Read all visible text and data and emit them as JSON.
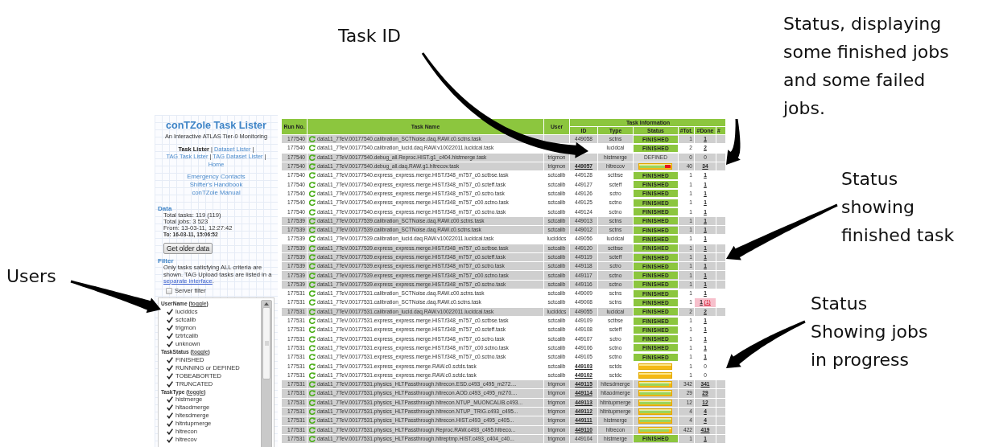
{
  "callouts": [
    {
      "text": "Task ID"
    },
    {
      "text": "Status, displaying\nsome finished jobs\nand some failed\njobs."
    },
    {
      "text": "Status\nshowing\nfinished task"
    },
    {
      "text": "Users"
    },
    {
      "text": "Status\nShowing jobs\nin progress"
    }
  ],
  "sidebar": {
    "title": "conTZole Task Lister",
    "subtitle": "An Interactive ATLAS Tier-0 Monitoring",
    "nav": [
      {
        "label": "Task Lister",
        "current": true
      },
      {
        "label": "Dataset Lister",
        "current": false
      },
      {
        "label": "TAG Task Lister",
        "current": false
      },
      {
        "label": "TAG Dataset Lister",
        "current": false
      },
      {
        "label": "Home",
        "current": false
      }
    ],
    "separator": "|",
    "links": [
      "Emergency Contacts",
      "Shifter's Handbook",
      "conTZole Manual"
    ],
    "data": {
      "heading": "Data",
      "lines": [
        {
          "text": "Total tasks: 119 (119)",
          "bold": false
        },
        {
          "text": "Total jobs: 3 523",
          "bold": false
        },
        {
          "text": "From: 13-03-11, 12:27:42",
          "bold": false
        },
        {
          "text": "To: 16-03-11, 15:06:52",
          "bold": true
        }
      ]
    },
    "older_button": "Get older data",
    "filter": {
      "heading": "Filter",
      "text": "Only tasks satisfying ALL criteria are shown. TAG Upload tasks are listed in a ",
      "link": "separate interface",
      "end": "."
    },
    "server_filter": {
      "label": "Server filter",
      "checked": false
    },
    "toggle_brackets": [
      "(",
      ")"
    ],
    "groups": [
      {
        "heading": "UserName",
        "toggle": "toggle",
        "items": [
          {
            "label": "luciddcs",
            "checked": true
          },
          {
            "label": "sctcalib",
            "checked": true
          },
          {
            "label": "trigmon",
            "checked": true
          },
          {
            "label": "tztrtcalib",
            "checked": true
          },
          {
            "label": "unknown",
            "checked": true
          }
        ]
      },
      {
        "heading": "TaskStatus",
        "toggle": "toggle",
        "items": [
          {
            "label": "FINISHED",
            "checked": true
          },
          {
            "label": "RUNNING or DEFINED",
            "checked": true
          },
          {
            "label": "TOBEABORTED",
            "checked": true
          },
          {
            "label": "TRUNCATED",
            "checked": true
          }
        ]
      },
      {
        "heading": "TaskType",
        "toggle": "toggle",
        "items": [
          {
            "label": "histmerge",
            "checked": true
          },
          {
            "label": "hltaodmerge",
            "checked": true
          },
          {
            "label": "hltesdmerge",
            "checked": true
          },
          {
            "label": "hltntupmerge",
            "checked": true
          },
          {
            "label": "hltrecon",
            "checked": true
          },
          {
            "label": "hltrecov",
            "checked": true
          }
        ]
      }
    ]
  },
  "table": {
    "group_header": "Task Information",
    "columns": [
      {
        "label": "Run No.",
        "grouped": false
      },
      {
        "label": "Task Name",
        "grouped": false
      },
      {
        "label": "User",
        "grouped": false
      },
      {
        "label": "ID",
        "grouped": true
      },
      {
        "label": "Type",
        "grouped": true
      },
      {
        "label": "Status",
        "grouped": true
      },
      {
        "label": "#Tot.",
        "grouped": true
      },
      {
        "label": "#Done",
        "grouped": true
      },
      {
        "label": "#",
        "grouped": true
      }
    ],
    "rows": [
      {
        "run": "177540",
        "name": "data11_7TeV.00177540.calibration_SCTNoise.daq.RAW.c0.sctns.task",
        "id": "449058",
        "id_link": false,
        "type": "sctns",
        "status": {
          "kind": "finished",
          "text": "FINISHED"
        },
        "total": "1",
        "done": "1",
        "done_link": true,
        "shaded": true
      },
      {
        "run": "177540",
        "name": "data11_7TeV.00177540.calibration_lucid.daq.RAW.v10022011.lucidcal.task",
        "type": "lucidcal",
        "status": {
          "kind": "finished",
          "text": "FINISHED"
        },
        "total": "2",
        "done": "2",
        "done_link": true,
        "shaded": false
      },
      {
        "run": "177540",
        "name": "data11_7TeV.00177540.debug_all.Reproc.HIST.g1_c404.histmerge.task",
        "user": "trigmon",
        "type": "histmerge",
        "status": {
          "kind": "defined",
          "text": "DEFINED"
        },
        "total": "0",
        "done": "0",
        "done_link": false,
        "shaded": true
      },
      {
        "run": "177540",
        "name": "data11_7TeV.00177540.debug_all.daq.RAW.g1.hltrecov.task",
        "user": "trigmon",
        "id": "449057",
        "id_link": true,
        "type": "hltrecov",
        "status": {
          "kind": "progress",
          "level": 0.82,
          "failures": true
        },
        "total": "40",
        "done": "34",
        "done_link": true,
        "shaded": true
      },
      {
        "run": "177540",
        "name": "data11_7TeV.00177540.express_express.merge.HIST.f348_m757_c0.sctbse.task",
        "user": "sctcalib",
        "id": "449128",
        "id_link": false,
        "type": "sctbse",
        "status": {
          "kind": "finished",
          "text": "FINISHED"
        },
        "total": "1",
        "done": "1",
        "done_link": true,
        "shaded": false
      },
      {
        "run": "177540",
        "name": "data11_7TeV.00177540.express_express.merge.HIST.f348_m757_c0.scteff.task",
        "user": "sctcalib",
        "id": "449127",
        "id_link": false,
        "type": "scteff",
        "status": {
          "kind": "finished",
          "text": "FINISHED"
        },
        "total": "1",
        "done": "1",
        "done_link": true,
        "shaded": false
      },
      {
        "run": "177540",
        "name": "data11_7TeV.00177540.express_express.merge.HIST.f348_m757_c0.sctro.task",
        "user": "sctcalib",
        "id": "449126",
        "id_link": false,
        "type": "sctro",
        "status": {
          "kind": "finished",
          "text": "FINISHED"
        },
        "total": "1",
        "done": "1",
        "done_link": true,
        "shaded": false
      },
      {
        "run": "177540",
        "name": "data11_7TeV.00177540.express_express.merge.HIST.f348_m757_c00.sctno.task",
        "user": "sctcalib",
        "id": "449125",
        "id_link": false,
        "type": "sctno",
        "status": {
          "kind": "finished",
          "text": "FINISHED"
        },
        "total": "1",
        "done": "1",
        "done_link": true,
        "shaded": false
      },
      {
        "run": "177540",
        "name": "data11_7TeV.00177540.express_express.merge.HIST.f348_m757_c0.sctno.task",
        "user": "sctcalib",
        "id": "449124",
        "id_link": false,
        "type": "sctno",
        "status": {
          "kind": "finished",
          "text": "FINISHED"
        },
        "total": "1",
        "done": "1",
        "done_link": true,
        "shaded": false
      },
      {
        "run": "177539",
        "name": "data11_7TeV.00177539.calibration_SCTNoise.daq.RAW.c00.sctns.task",
        "user": "sctcalib",
        "id": "449013",
        "id_link": false,
        "type": "sctns",
        "status": {
          "kind": "finished",
          "text": "FINISHED"
        },
        "total": "1",
        "done": "1",
        "done_link": true,
        "shaded": true
      },
      {
        "run": "177539",
        "name": "data11_7TeV.00177539.calibration_SCTNoise.daq.RAW.c0.sctns.task",
        "user": "sctcalib",
        "id": "449012",
        "id_link": false,
        "type": "sctns",
        "status": {
          "kind": "finished",
          "text": "FINISHED"
        },
        "total": "1",
        "done": "1",
        "done_link": true,
        "shaded": true
      },
      {
        "run": "177539",
        "name": "data11_7TeV.00177539.calibration_lucid.daq.RAW.v10022011.lucidcal.task",
        "user": "luciddcs",
        "id": "449056",
        "id_link": false,
        "type": "lucidcal",
        "status": {
          "kind": "finished",
          "text": "FINISHED"
        },
        "total": "1",
        "done": "1",
        "done_link": true,
        "shaded": false
      },
      {
        "run": "177539",
        "name": "data11_7TeV.00177539.express_express.merge.HIST.f348_m757_c0.sctbse.task",
        "user": "sctcalib",
        "id": "449120",
        "id_link": false,
        "type": "sctbse",
        "status": {
          "kind": "finished",
          "text": "FINISHED"
        },
        "total": "1",
        "done": "1",
        "done_link": true,
        "shaded": true
      },
      {
        "run": "177539",
        "name": "data11_7TeV.00177539.express_express.merge.HIST.f348_m757_c0.scteff.task",
        "user": "sctcalib",
        "id": "449119",
        "id_link": false,
        "type": "scteff",
        "status": {
          "kind": "finished",
          "text": "FINISHED"
        },
        "total": "1",
        "done": "1",
        "done_link": true,
        "shaded": true
      },
      {
        "run": "177539",
        "name": "data11_7TeV.00177539.express_express.merge.HIST.f348_m757_c0.sctro.task",
        "user": "sctcalib",
        "id": "449118",
        "id_link": false,
        "type": "sctro",
        "status": {
          "kind": "finished",
          "text": "FINISHED"
        },
        "total": "1",
        "done": "1",
        "done_link": true,
        "shaded": true
      },
      {
        "run": "177539",
        "name": "data11_7TeV.00177539.express_express.merge.HIST.f348_m757_c00.sctno.task",
        "user": "sctcalib",
        "id": "449117",
        "id_link": false,
        "type": "sctno",
        "status": {
          "kind": "finished",
          "text": "FINISHED"
        },
        "total": "1",
        "done": "1",
        "done_link": true,
        "shaded": true
      },
      {
        "run": "177539",
        "name": "data11_7TeV.00177539.express_express.merge.HIST.f348_m757_c0.sctno.task",
        "user": "sctcalib",
        "id": "449116",
        "id_link": false,
        "type": "sctno",
        "status": {
          "kind": "finished",
          "text": "FINISHED"
        },
        "total": "1",
        "done": "1",
        "done_link": true,
        "shaded": true
      },
      {
        "run": "177531",
        "name": "data11_7TeV.00177531.calibration_SCTNoise.daq.RAW.c00.sctns.task",
        "user": "sctcalib",
        "id": "449009",
        "id_link": false,
        "type": "sctns",
        "status": {
          "kind": "finished",
          "text": "FINISHED"
        },
        "total": "1",
        "done": "1",
        "done_link": true,
        "shaded": false
      },
      {
        "run": "177531",
        "name": "data11_7TeV.00177531.calibration_SCTNoise.daq.RAW.c0.sctns.task",
        "user": "sctcalib",
        "id": "449008",
        "id_link": false,
        "type": "sctns",
        "status": {
          "kind": "finished",
          "text": "FINISHED"
        },
        "total": "1",
        "done": "1",
        "done_link": true,
        "failed": "(1)",
        "shaded": false
      },
      {
        "run": "177531",
        "name": "data11_7TeV.00177531.calibration_lucid.daq.RAW.v10022011.lucidcal.task",
        "user": "luciddcs",
        "id": "449055",
        "id_link": false,
        "type": "lucidcal",
        "status": {
          "kind": "finished",
          "text": "FINISHED"
        },
        "total": "2",
        "done": "2",
        "done_link": true,
        "shaded": true
      },
      {
        "run": "177531",
        "name": "data11_7TeV.00177531.express_express.merge.HIST.f348_m757_c0.sctbse.task",
        "user": "sctcalib",
        "id": "449109",
        "id_link": false,
        "type": "sctbse",
        "status": {
          "kind": "finished",
          "text": "FINISHED"
        },
        "total": "1",
        "done": "1",
        "done_link": true,
        "shaded": false
      },
      {
        "run": "177531",
        "name": "data11_7TeV.00177531.express_express.merge.HIST.f348_m757_c0.scteff.task",
        "user": "sctcalib",
        "id": "449108",
        "id_link": false,
        "type": "scteff",
        "status": {
          "kind": "finished",
          "text": "FINISHED"
        },
        "total": "1",
        "done": "1",
        "done_link": true,
        "shaded": false
      },
      {
        "run": "177531",
        "name": "data11_7TeV.00177531.express_express.merge.HIST.f348_m757_c0.sctro.task",
        "user": "sctcalib",
        "id": "449107",
        "id_link": false,
        "type": "sctro",
        "status": {
          "kind": "finished",
          "text": "FINISHED"
        },
        "total": "1",
        "done": "1",
        "done_link": true,
        "shaded": false
      },
      {
        "run": "177531",
        "name": "data11_7TeV.00177531.express_express.merge.HIST.f348_m757_c00.sctno.task",
        "user": "sctcalib",
        "id": "449106",
        "id_link": false,
        "type": "sctno",
        "status": {
          "kind": "finished",
          "text": "FINISHED"
        },
        "total": "1",
        "done": "1",
        "done_link": true,
        "shaded": false
      },
      {
        "run": "177531",
        "name": "data11_7TeV.00177531.express_express.merge.HIST.f348_m757_c0.sctno.task",
        "user": "sctcalib",
        "id": "449105",
        "id_link": false,
        "type": "sctno",
        "status": {
          "kind": "finished",
          "text": "FINISHED"
        },
        "total": "1",
        "done": "1",
        "done_link": true,
        "shaded": false
      },
      {
        "run": "177531",
        "name": "data11_7TeV.00177531.express_express.merge.RAW.c0.sctds.task",
        "user": "sctcalib",
        "id": "449103",
        "id_link": true,
        "type": "sctds",
        "status": {
          "kind": "pending"
        },
        "total": "1",
        "done": "0",
        "done_link": false,
        "shaded": false
      },
      {
        "run": "177531",
        "name": "data11_7TeV.00177531.express_express.merge.RAW.c0.sctdc.task",
        "user": "sctcalib",
        "id": "449102",
        "id_link": true,
        "type": "sctdc",
        "status": {
          "kind": "pending"
        },
        "total": "1",
        "done": "0",
        "done_link": false,
        "shaded": false
      },
      {
        "run": "177531",
        "name": "data11_7TeV.00177531.physics_HLTPassthrough.hltrecon.ESD.c493_c495_m272....",
        "user": "trigmon",
        "id": "449115",
        "id_link": true,
        "type": "hltesdmerge",
        "status": {
          "kind": "progress",
          "level": 0.96,
          "failures": false
        },
        "total": "342",
        "done": "341",
        "done_link": true,
        "shaded": true
      },
      {
        "run": "177531",
        "name": "data11_7TeV.00177531.physics_HLTPassthrough.hltrecon.AOD.c493_c495_m270....",
        "user": "trigmon",
        "id": "449114",
        "id_link": true,
        "type": "hltaodmerge",
        "status": {
          "kind": "progress",
          "level": 1,
          "failures": false
        },
        "total": "29",
        "done": "29",
        "done_link": true,
        "shaded": true
      },
      {
        "run": "177531",
        "name": "data11_7TeV.00177531.physics_HLTPassthrough.hltrecon.NTUP_MUONCALIB.c493...",
        "user": "trigmon",
        "id": "449113",
        "id_link": true,
        "type": "hltntupmerge",
        "status": {
          "kind": "progress",
          "level": 1,
          "failures": false
        },
        "total": "12",
        "done": "12",
        "done_link": true,
        "shaded": true
      },
      {
        "run": "177531",
        "name": "data11_7TeV.00177531.physics_HLTPassthrough.hltrecon.NTUP_TRIG.c493_c495...",
        "user": "trigmon",
        "id": "449112",
        "id_link": true,
        "type": "hltntupmerge",
        "status": {
          "kind": "progress",
          "level": 1,
          "failures": false
        },
        "total": "4",
        "done": "4",
        "done_link": true,
        "shaded": true
      },
      {
        "run": "177531",
        "name": "data11_7TeV.00177531.physics_HLTPassthrough.hltrecon.HIST.c493_c495_c405...",
        "user": "trigmon",
        "id": "449111",
        "id_link": true,
        "type": "histmerge",
        "status": {
          "kind": "progress",
          "level": 1,
          "failures": false
        },
        "total": "4",
        "done": "4",
        "done_link": true,
        "shaded": true
      },
      {
        "run": "177531",
        "name": "data11_7TeV.00177531.physics_HLTPassthrough.Reproc.RAW.c493_c495.hltreco...",
        "user": "trigmon",
        "id": "449110",
        "id_link": true,
        "type": "hltrecon",
        "status": {
          "kind": "progress",
          "level": 0.96,
          "failures": false
        },
        "total": "422",
        "done": "419",
        "done_link": true,
        "shaded": true
      },
      {
        "run": "177531",
        "name": "data11_7TeV.00177531.physics_HLTPassthrough.hltreptmp.HIST.c493_c404_c40...",
        "user": "trigmon",
        "id": "449104",
        "id_link": false,
        "type": "histmerge",
        "status": {
          "kind": "finished",
          "text": "FINISHED"
        },
        "total": "1",
        "done": "1",
        "done_link": true,
        "shaded": true
      }
    ]
  }
}
